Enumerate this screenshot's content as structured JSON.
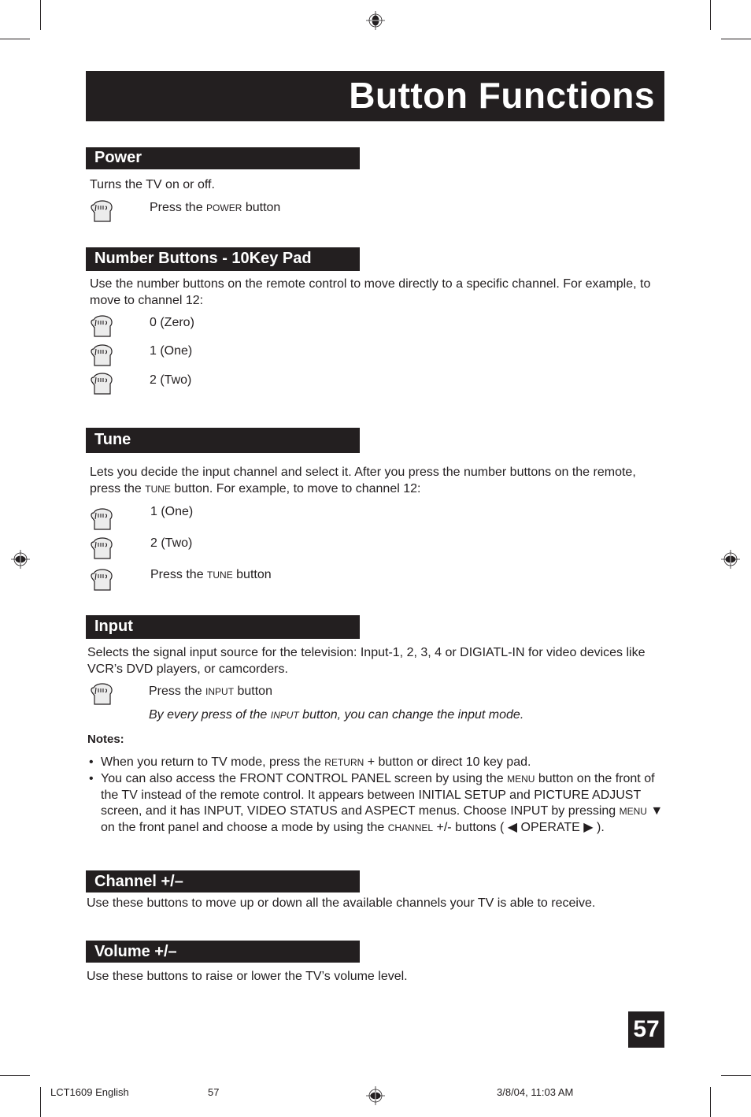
{
  "header": {
    "title": "Button Functions"
  },
  "sections": {
    "power": {
      "heading": "Power",
      "description": "Turns the TV on or off.",
      "steps": [
        {
          "pre": "Press the ",
          "sc": "Power",
          "post": " button"
        }
      ]
    },
    "number": {
      "heading": "Number Buttons - 10Key Pad",
      "description": "Use the number buttons on the remote control to move directly to a specific channel. For example, to move to channel 12:",
      "steps": [
        "0 (Zero)",
        "1 (One)",
        "2 (Two)"
      ]
    },
    "tune": {
      "heading": "Tune",
      "description_pre": "Lets you decide the input channel and select it.  After you press the number buttons on the remote, press the ",
      "description_sc": "Tune",
      "description_post": " button.  For example, to move to channel 12:",
      "steps": [
        "1 (One)",
        "2 (Two)",
        {
          "pre": "Press the ",
          "sc": "Tune",
          "post": " button"
        }
      ]
    },
    "input": {
      "heading": "Input",
      "description": "Selects the signal input source for the television:  Input-1, 2, 3, 4 or DIGIATL-IN for video devices like VCR’s DVD players, or camcorders.",
      "steps": [
        {
          "pre": "Press the ",
          "sc": "Input",
          "post": " button"
        }
      ],
      "note_italic": {
        "pre": "By every press of the ",
        "sc": "Input",
        "post": " button, you can change the input mode."
      },
      "notes_label": "Notes:",
      "notes": [
        {
          "a": "When you return to TV mode, press the ",
          "b": "Return",
          "c": " + button or direct 10 key pad."
        },
        {
          "a": "You can also access the FRONT CONTROL PANEL screen by using the ",
          "b": "Menu",
          "c": " button on the front of the TV instead of the remote control.  It appears between INITIAL SETUP and PICTURE ADJUST screen, and it has INPUT, VIDEO STATUS and ASPECT menus. Choose INPUT by pressing ",
          "d": "Menu",
          "e": " ▼ on the front panel and choose a mode by using the ",
          "f": "Channel",
          "g": " +/- buttons ( ◀ OPERATE ▶ )."
        }
      ]
    },
    "channel": {
      "heading": "Channel +/–",
      "description": "Use these buttons to move up or down all the available channels your TV is able to receive."
    },
    "volume": {
      "heading": "Volume +/–",
      "description": "Use these buttons to raise or lower the TV’s volume level."
    }
  },
  "page_number": "57",
  "footer": {
    "doc": "LCT1609 English",
    "page": "57",
    "date": "3/8/04, 11:03 AM"
  },
  "icons": {
    "hand": "hand-press-icon",
    "registration": "registration-mark-icon"
  }
}
